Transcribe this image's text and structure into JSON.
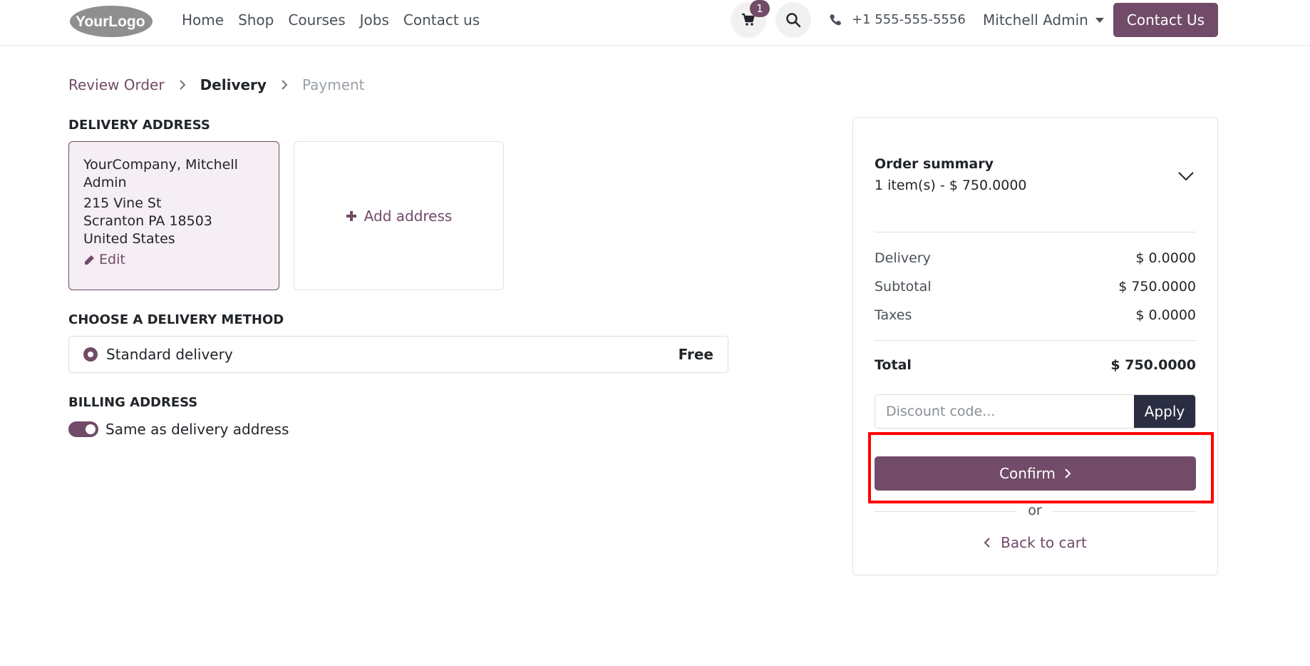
{
  "header": {
    "logo_text": "YourLogo",
    "nav": [
      "Home",
      "Shop",
      "Courses",
      "Jobs",
      "Contact us"
    ],
    "cart_count": "1",
    "phone": "+1 555-555-5556",
    "user": "Mitchell Admin",
    "contact_button": "Contact Us"
  },
  "breadcrumb": {
    "step1": "Review Order",
    "step2": "Delivery",
    "step3": "Payment"
  },
  "delivery_address": {
    "title": "DELIVERY ADDRESS",
    "name_line1": "YourCompany, Mitchell",
    "name_line2": "Admin",
    "street": "215 Vine St",
    "city": "Scranton PA 18503",
    "country": "United States",
    "edit_label": "Edit",
    "add_label": "Add address"
  },
  "delivery_method": {
    "title": "CHOOSE A DELIVERY METHOD",
    "option_label": "Standard delivery",
    "option_price": "Free"
  },
  "billing": {
    "title": "BILLING ADDRESS",
    "same_label": "Same as delivery address"
  },
  "summary": {
    "title": "Order summary",
    "items_line": "1 item(s) -  $ 750.0000",
    "delivery_label": "Delivery",
    "delivery_value": "$ 0.0000",
    "subtotal_label": "Subtotal",
    "subtotal_value": "$ 750.0000",
    "taxes_label": "Taxes",
    "taxes_value": "$ 0.0000",
    "total_label": "Total",
    "total_value": "$ 750.0000",
    "discount_placeholder": "Discount code...",
    "apply_label": "Apply",
    "confirm_label": "Confirm",
    "or_label": "or",
    "back_label": "Back to cart"
  },
  "colors": {
    "brand": "#714b67",
    "dark_button": "#2b2d42",
    "highlight": "#ff0000"
  }
}
